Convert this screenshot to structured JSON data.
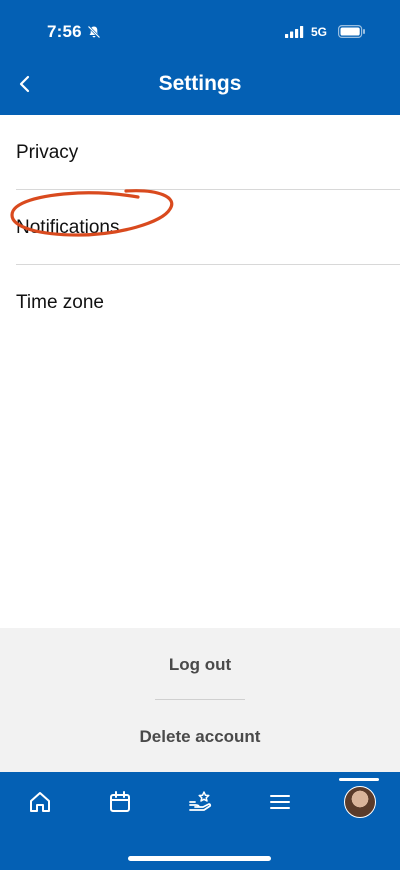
{
  "status_bar": {
    "time": "7:56",
    "network": "5G"
  },
  "header": {
    "title": "Settings",
    "back_icon": "chevron-left-icon"
  },
  "settings": {
    "items": [
      {
        "label": "Privacy"
      },
      {
        "label": "Notifications"
      },
      {
        "label": "Time zone"
      }
    ]
  },
  "account": {
    "logout_label": "Log out",
    "delete_label": "Delete account"
  },
  "tab_bar": {
    "tabs": [
      "home-icon",
      "calendar-icon",
      "hand-star-icon",
      "menu-icon",
      "profile-avatar"
    ],
    "active": "profile-avatar"
  },
  "colors": {
    "brand": "#0460b4",
    "annotation": "#d94a1e",
    "bottom_panel": "#f2f2f2"
  }
}
